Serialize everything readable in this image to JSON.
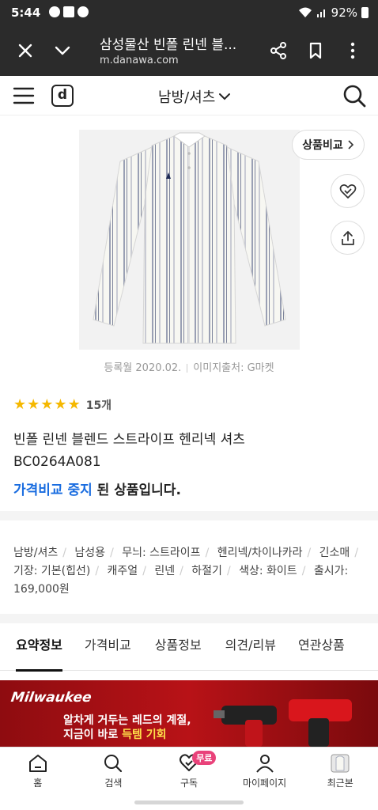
{
  "status": {
    "time": "5:44",
    "battery": "92%"
  },
  "browser": {
    "title": "삼성물산 빈폴 린넨 블...",
    "url": "m.danawa.com"
  },
  "header": {
    "logo": "d",
    "category": "남방/셔츠"
  },
  "product": {
    "compare_label": "상품비교",
    "register_date": "등록월 2020.02.",
    "image_source": "이미지출처: G마켓",
    "rating_stars": 5,
    "review_count": "15개",
    "name_line1": "빈폴 린넨 블렌드 스트라이프 헨리넥 셔츠",
    "name_line2": "BC0264A081",
    "stopped_blue": "가격비교 중지",
    "stopped_rest": " 된 상품입니다."
  },
  "specs": [
    "남방/셔츠",
    "남성용",
    "무늬: 스트라이프",
    "헨리넥/차이나카라",
    "긴소매",
    "기장: 기본(힙선)",
    "캐주얼",
    "린넨",
    "하절기",
    "색상: 화이트",
    "출시가: 169,000원"
  ],
  "tabs": [
    "요약정보",
    "가격비교",
    "상품정보",
    "의견/리뷰",
    "연관상품"
  ],
  "banner": {
    "brand": "Milwaukee",
    "line1": "알차게 거두는 레드의 계절,",
    "line2_white": "지금이 바로 ",
    "line2_yellow": "득템 기회"
  },
  "bottom_nav": [
    {
      "label": "홈",
      "icon": "home-icon"
    },
    {
      "label": "검색",
      "icon": "search-icon"
    },
    {
      "label": "구독",
      "icon": "heart-check-icon",
      "badge": "무료"
    },
    {
      "label": "마이페이지",
      "icon": "person-icon"
    },
    {
      "label": "최근본",
      "icon": "recent-thumbnail-icon"
    }
  ],
  "colors": {
    "accent_blue": "#1a6de0",
    "star": "#f5b800",
    "badge_pink": "#e9427a",
    "dark_bar": "#2b2b2b"
  }
}
